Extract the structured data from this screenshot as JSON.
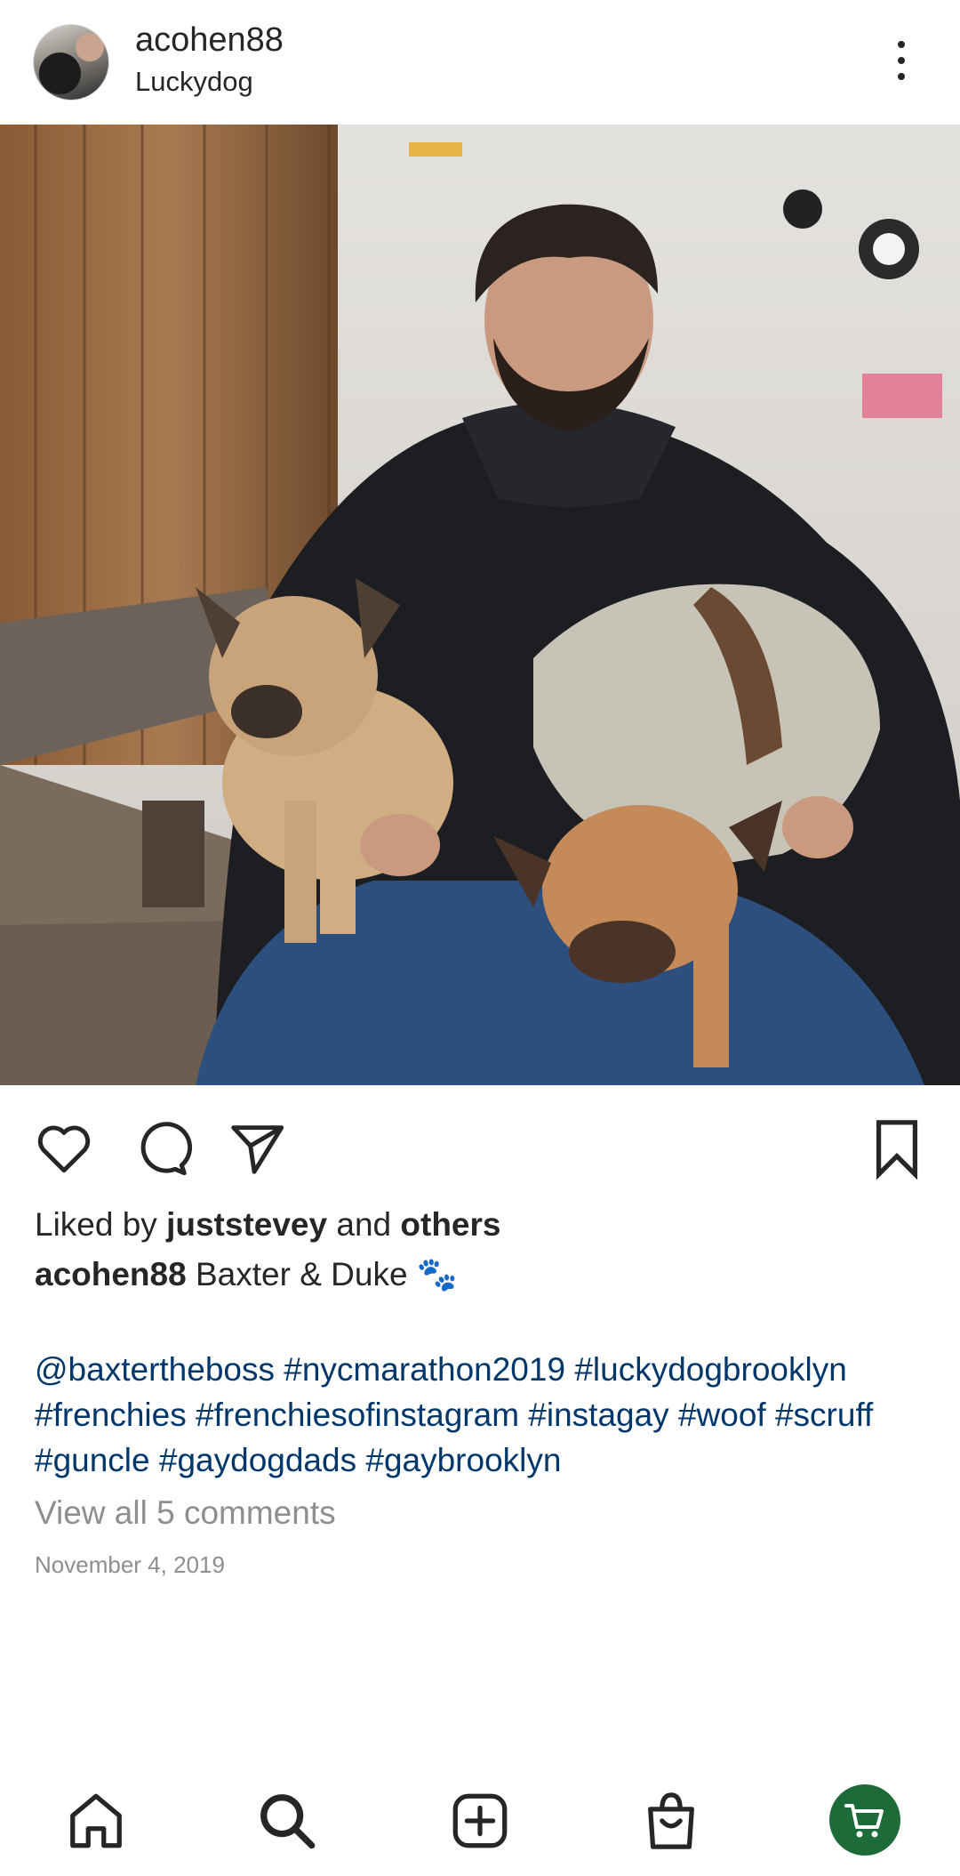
{
  "post": {
    "username": "acohen88",
    "location": "Luckydog"
  },
  "likes": {
    "prefix": "Liked by",
    "user": "juststevey",
    "middle": "and",
    "others": "others"
  },
  "caption": {
    "username": "acohen88",
    "text": "Baxter & Duke",
    "emoji": "🐾"
  },
  "hashtags": {
    "line1": "@baxtertheboss #nycmarathon2019 #luckydogbrooklyn",
    "line2": "#frenchies #frenchiesofinstagram #instagay #woof #scruff",
    "line3": "#guncle #gaydogdads #gaybrooklyn"
  },
  "comments_link": "View all 5 comments",
  "date": "November 4, 2019",
  "icons": {
    "more": "more-vertical-icon",
    "like": "heart-icon",
    "comment": "comment-icon",
    "share": "send-icon",
    "save": "bookmark-icon",
    "home": "home-icon",
    "search": "search-icon",
    "create": "add-post-icon",
    "shop": "shopping-bag-icon",
    "cart": "shopping-cart-icon"
  },
  "colors": {
    "hashtag": "#00376b",
    "muted": "#8e8e8e",
    "shop_button": "#1e6b3a"
  }
}
